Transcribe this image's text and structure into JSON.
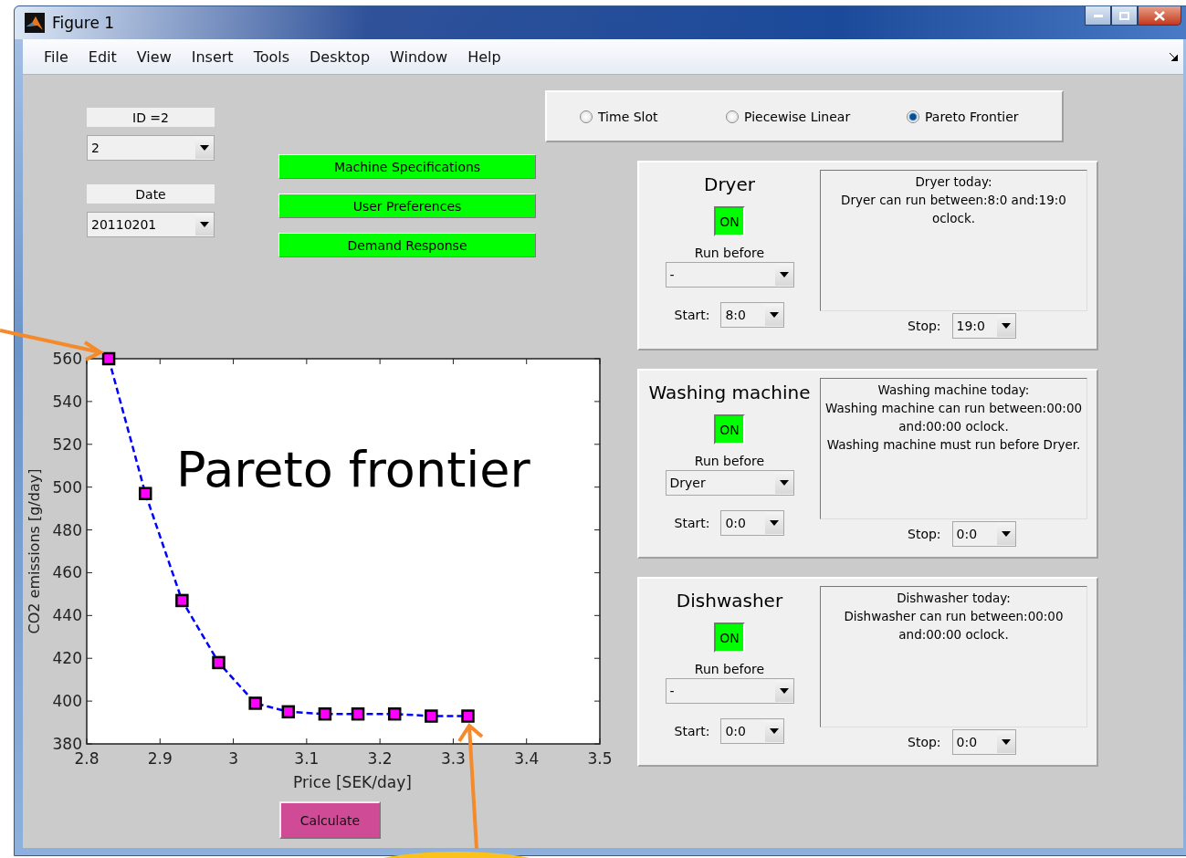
{
  "window": {
    "title": "Figure 1"
  },
  "menu": [
    "File",
    "Edit",
    "View",
    "Insert",
    "Tools",
    "Desktop",
    "Window",
    "Help"
  ],
  "id_label": "ID =2",
  "id_select": "2",
  "date_label": "Date",
  "date_select": "20110201",
  "actions": [
    "Machine Specifications",
    "User Preferences",
    "Demand Response"
  ],
  "modes": [
    {
      "label": "Time Slot",
      "selected": false
    },
    {
      "label": "Piecewise Linear",
      "selected": false
    },
    {
      "label": "Pareto Frontier",
      "selected": true
    }
  ],
  "chart_data": {
    "type": "line",
    "xlabel": "Price [SEK/day]",
    "ylabel": "CO2 emissions [g/day]",
    "x": [
      2.83,
      2.88,
      2.93,
      2.98,
      3.03,
      3.075,
      3.125,
      3.17,
      3.22,
      3.27,
      3.32
    ],
    "series": [
      {
        "name": "Pareto frontier",
        "color": "#0000ff",
        "line_style": "dashed",
        "marker": "square",
        "values": [
          560,
          497,
          447,
          418,
          399,
          395,
          394,
          394,
          394,
          393,
          393
        ]
      }
    ],
    "xlim": [
      2.8,
      3.5
    ],
    "ylim": [
      380,
      560
    ],
    "xticks": [
      2.8,
      2.9,
      3,
      3.1,
      3.2,
      3.3,
      3.4,
      3.5
    ],
    "yticks": [
      380,
      400,
      420,
      440,
      460,
      480,
      500,
      520,
      540,
      560
    ]
  },
  "calculate": "Calculate",
  "devices": [
    {
      "name": "Dryer",
      "toggle": "ON",
      "on": true,
      "run_before_label": "Run before",
      "run_before": "-",
      "start_label": "Start:",
      "start": "8:0",
      "stop_label": "Stop:",
      "stop": "19:0",
      "info": [
        "Dryer today:",
        "Dryer can run between:8:0 and:19:0 oclock."
      ]
    },
    {
      "name": "Washing machine",
      "toggle": "ON",
      "on": true,
      "run_before_label": "Run before",
      "run_before": "Dryer",
      "start_label": "Start:",
      "start": "0:0",
      "stop_label": "Stop:",
      "stop": "0:0",
      "info": [
        "Washing machine today:",
        "Washing machine can run between:00:00 and:00:00 oclock.",
        "Washing machine must run before Dryer."
      ]
    },
    {
      "name": "Dishwasher",
      "toggle": "ON",
      "on": true,
      "run_before_label": "Run before",
      "run_before": "-",
      "start_label": "Start:",
      "start": "0:0",
      "stop_label": "Stop:",
      "stop": "0:0",
      "info": [
        "Dishwasher today:",
        "Dishwasher can run between:00:00 and:00:00 oclock."
      ]
    }
  ]
}
